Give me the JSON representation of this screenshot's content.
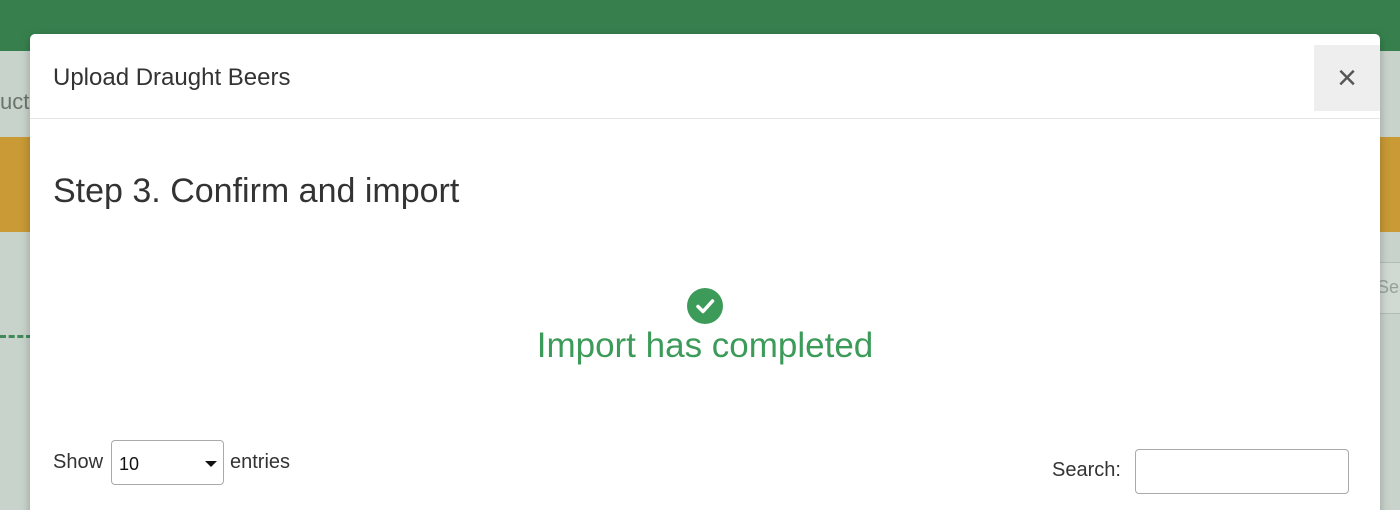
{
  "background": {
    "tab_fragment": "uct",
    "search_fragment": "Sea"
  },
  "modal": {
    "title": "Upload Draught Beers",
    "close_label": "×",
    "step_title": "Step 3. Confirm and import",
    "status": {
      "icon": "check-circle-icon",
      "message": "Import has completed",
      "color": "#3d9b5a"
    },
    "table_controls": {
      "show_label": "Show",
      "entries_value": "10",
      "entries_label": "entries",
      "search_label": "Search:",
      "search_value": ""
    }
  },
  "colors": {
    "topbar": "#37804e",
    "banner": "#c99a35",
    "success": "#3d9b5a"
  }
}
